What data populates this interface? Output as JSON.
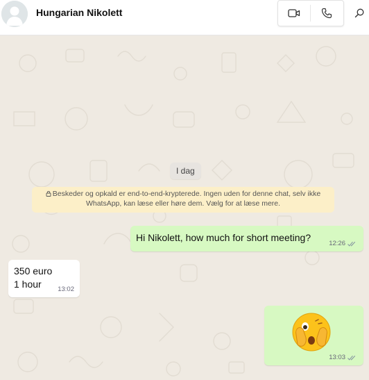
{
  "header": {
    "contact_name": "Hungarian Nikolett",
    "avatar_icon": "person-silhouette-icon",
    "video_icon": "video-camera-icon",
    "voice_icon": "phone-icon",
    "search_icon": "search-icon"
  },
  "chat": {
    "date_label": "I dag",
    "encryption_notice": "Beskeder og opkald er end-to-end-krypterede. Ingen uden for denne chat, selv ikke WhatsApp, kan læse eller høre dem. Vælg for at læse mere.",
    "messages": [
      {
        "direction": "outgoing",
        "text": "Hi Nikolett, how much for short meeting?",
        "time": "12:26",
        "status": "read"
      },
      {
        "direction": "incoming",
        "lines": [
          "350 euro",
          "1 hour"
        ],
        "time": "13:02"
      },
      {
        "direction": "outgoing",
        "emoji": "face-with-peeking-eye",
        "time": "13:03",
        "status": "read"
      }
    ]
  },
  "colors": {
    "chat_background": "#efeae2",
    "outgoing_bubble": "#d7f9c2",
    "incoming_bubble": "#ffffff",
    "encryption_banner": "#fcefc8"
  }
}
